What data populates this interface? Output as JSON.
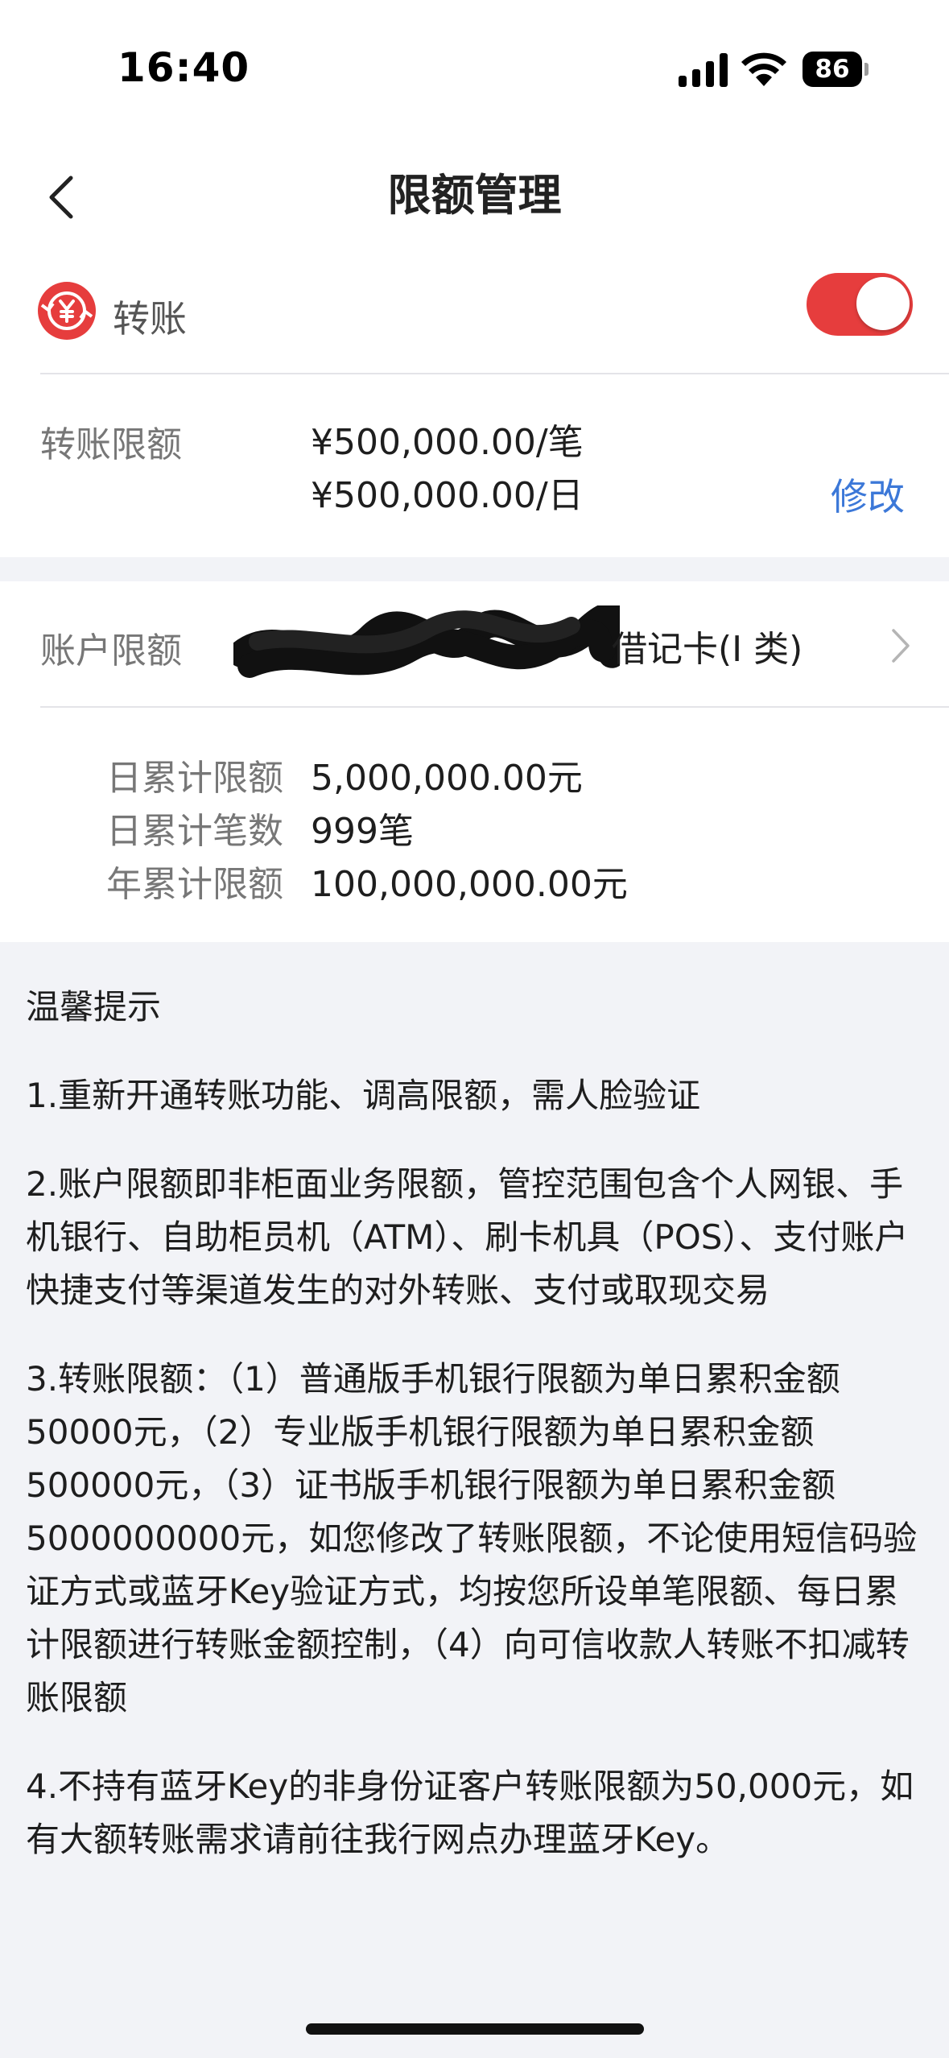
{
  "status_bar": {
    "time": "16:40",
    "battery": "86",
    "icons": [
      "signal-icon",
      "wifi-icon",
      "battery-icon"
    ]
  },
  "nav": {
    "title": "限额管理",
    "back_icon": "chevron-left-icon"
  },
  "transfer": {
    "label": "转账",
    "icon": "yuan-icon",
    "enabled": true,
    "toggle_color": "#e63d3d",
    "limit_label": "转账限额",
    "per_transaction": "¥500,000.00/笔",
    "per_day": "¥500,000.00/日",
    "modify": "修改"
  },
  "account": {
    "label": "账户限额",
    "card_type": "借记卡(I 类)",
    "stats": [
      {
        "label": "日累计限额",
        "value": "5,000,000.00元"
      },
      {
        "label": "日累计笔数",
        "value": "999笔"
      },
      {
        "label": "年累计限额",
        "value": "100,000,000.00元"
      }
    ]
  },
  "tips": {
    "title": "温馨提示",
    "items": [
      "1.重新开通转账功能、调高限额，需人脸验证",
      "2.账户限额即非柜面业务限额，管控范围包含个人网银、手机银行、自助柜员机（ATM）、刷卡机具（POS）、支付账户快捷支付等渠道发生的对外转账、支付或取现交易",
      "3.转账限额：（1）普通版手机银行限额为单日累积金额50000元，（2）专业版手机银行限额为单日累积金额500000元，（3）证书版手机银行限额为单日累积金额5000000000元，如您修改了转账限额，不论使用短信码验证方式或蓝牙Key验证方式，均按您所设单笔限额、每日累计限额进行转账金额控制，（4）向可信收款人转账不扣减转账限额",
      "4.不持有蓝牙Key的非身份证客户转账限额为50,000元，如有大额转账需求请前往我行网点办理蓝牙Key。"
    ]
  },
  "colors": {
    "accent_red": "#e63d3d",
    "link_blue": "#3c78d8",
    "page_bg": "#f2f3f7"
  }
}
